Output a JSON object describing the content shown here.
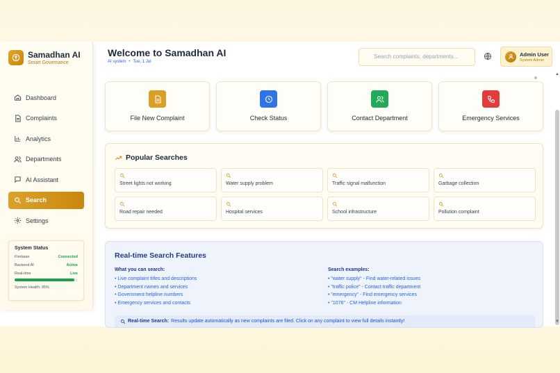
{
  "brand": {
    "title": "Samadhan AI",
    "subtitle": "Smart Governance"
  },
  "sidebar": {
    "items": [
      {
        "label": "Dashboard",
        "icon": "home-icon"
      },
      {
        "label": "Complaints",
        "icon": "document-icon"
      },
      {
        "label": "Analytics",
        "icon": "bar-chart-icon"
      },
      {
        "label": "Departments",
        "icon": "users-icon"
      },
      {
        "label": "AI Assistant",
        "icon": "chat-icon"
      },
      {
        "label": "Search",
        "icon": "search-icon",
        "active": true
      },
      {
        "label": "Settings",
        "icon": "gear-icon"
      }
    ],
    "status": {
      "title": "System Status",
      "rows": [
        {
          "label": "Firebase",
          "value": "Connected"
        },
        {
          "label": "Backend AI",
          "value": "Active"
        },
        {
          "label": "Real-time",
          "value": "Live"
        }
      ],
      "health_label": "System Health: 95%",
      "health_value": 0.95
    }
  },
  "header": {
    "title": "Welcome to Samadhan AI",
    "sub_left": "AI system",
    "sub_right": "Tue, 1 Jul",
    "search_placeholder": "Search complaints, departments...",
    "user_name": "Admin User",
    "user_role": "System Admin"
  },
  "actions": [
    {
      "label": "File New Complaint",
      "color": "#d99f26",
      "icon": "file-icon"
    },
    {
      "label": "Check Status",
      "color": "#2f74e6",
      "icon": "clock-icon"
    },
    {
      "label": "Contact Department",
      "color": "#22a95a",
      "icon": "users-icon"
    },
    {
      "label": "Emergency Services",
      "color": "#e23b3b",
      "icon": "phone-icon"
    }
  ],
  "popular": {
    "title": "Popular Searches",
    "items": [
      "Street lights not working",
      "Water supply problem",
      "Traffic signal malfunction",
      "Garbage collection",
      "Road repair needed",
      "Hospital services",
      "School infrastructure",
      "Pollution complaint"
    ]
  },
  "features": {
    "title": "Real-time Search Features",
    "left_head": "What you can search:",
    "left_items": [
      "• Live complaint titles and descriptions",
      "• Department names and services",
      "• Government helpline numbers",
      "• Emergency services and contacts"
    ],
    "right_head": "Search examples:",
    "right_items": [
      "• \"water supply\" - Find water-related issues",
      "• \"traffic police\" - Contact traffic department",
      "• \"emergency\" - Find emergency services",
      "• \"1076\" - CM Helpline information"
    ],
    "note_bold": "Real-time Search:",
    "note_text": "Results update automatically as new complaints are filed. Click on any complaint to view full details instantly!"
  },
  "colors": {
    "accent": "#d49a22",
    "blue": "#2563eb",
    "success": "#16a34a"
  }
}
